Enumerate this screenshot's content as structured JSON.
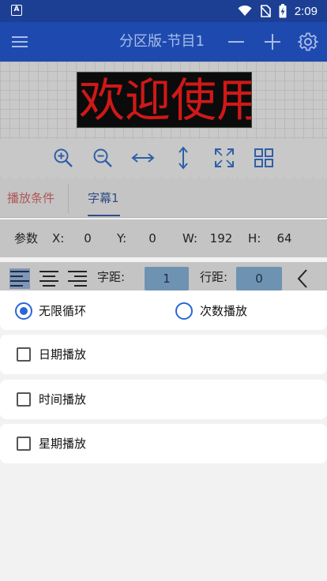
{
  "status_bar": {
    "time": "2:09",
    "app_badge": "A"
  },
  "app_bar": {
    "title": "分区版-节目1"
  },
  "preview": {
    "led_text": "欢迎使用",
    "text_color": "#d01818"
  },
  "tabs": [
    {
      "label": "播放条件"
    },
    {
      "label": "字幕1"
    }
  ],
  "params": {
    "title": "参数",
    "x_label": "X:",
    "x_value": "0",
    "y_label": "Y:",
    "y_value": "0",
    "w_label": "W:",
    "w_value": "192",
    "h_label": "H:",
    "h_value": "64"
  },
  "align_row": {
    "char_spacing_label": "字距:",
    "char_spacing_value": "1",
    "line_spacing_label": "行距:",
    "line_spacing_value": "0"
  },
  "sheet": {
    "loop_mode": [
      {
        "label": "无限循环",
        "selected": true
      },
      {
        "label": "次数播放",
        "selected": false
      }
    ],
    "conditions": [
      {
        "label": "日期播放",
        "checked": false
      },
      {
        "label": "时间播放",
        "checked": false
      },
      {
        "label": "星期播放",
        "checked": false
      }
    ]
  },
  "colors": {
    "primary": "#1e4ab0",
    "accent": "#2a66d8"
  }
}
